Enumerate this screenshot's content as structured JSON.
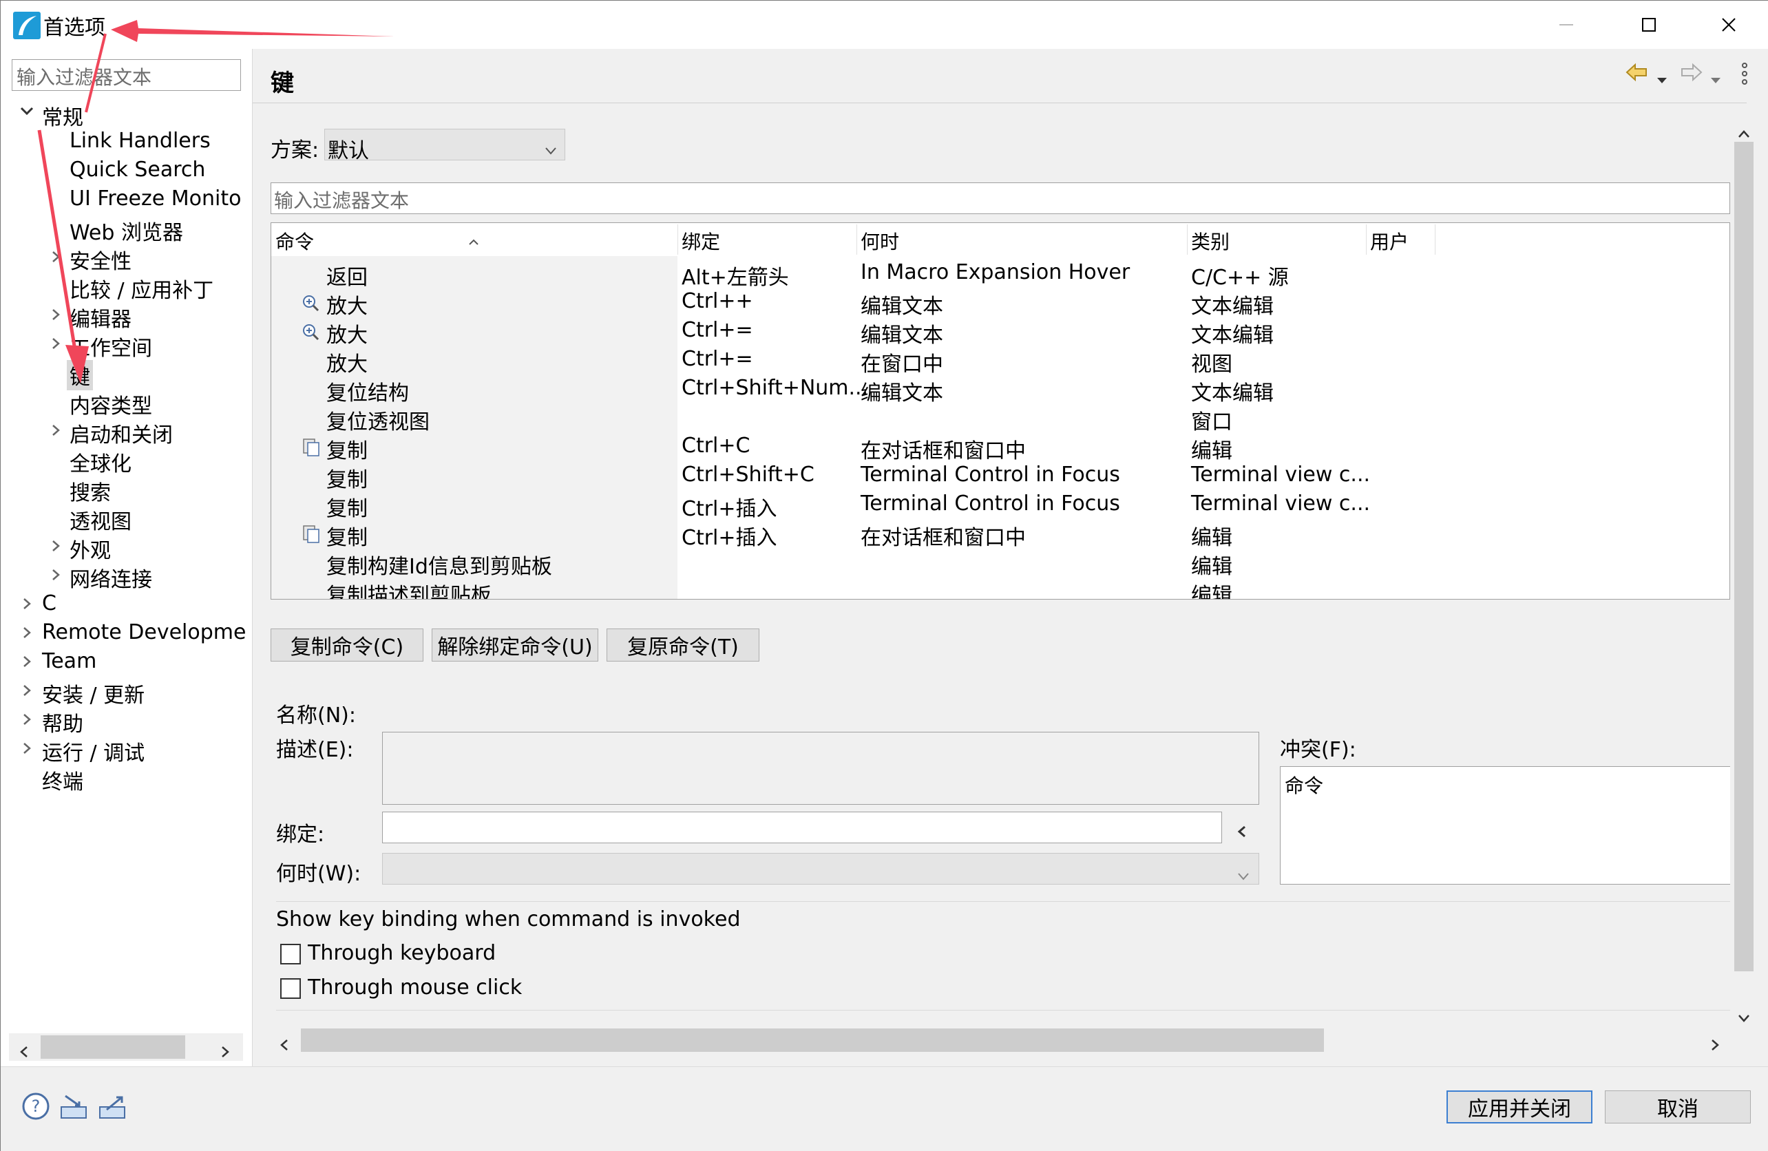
{
  "window": {
    "title": "首选项"
  },
  "left": {
    "filter_placeholder": "输入过滤器文本",
    "tree": [
      {
        "label": "常规",
        "expandable": true,
        "expanded": true
      },
      {
        "label": "Link Handlers"
      },
      {
        "label": "Quick Search"
      },
      {
        "label": "UI Freeze Monito"
      },
      {
        "label": "Web 浏览器"
      },
      {
        "label": "安全性",
        "expandable": true
      },
      {
        "label": "比较 / 应用补丁"
      },
      {
        "label": "编辑器",
        "expandable": true
      },
      {
        "label": "工作空间",
        "expandable": true
      },
      {
        "label": "键",
        "selected": true
      },
      {
        "label": "内容类型"
      },
      {
        "label": "启动和关闭",
        "expandable": true
      },
      {
        "label": "全球化"
      },
      {
        "label": "搜索"
      },
      {
        "label": "透视图"
      },
      {
        "label": "外观",
        "expandable": true
      },
      {
        "label": "网络连接",
        "expandable": true
      },
      {
        "label": "C",
        "expandable": true
      },
      {
        "label": "Remote Developme",
        "expandable": true
      },
      {
        "label": "Team",
        "expandable": true
      },
      {
        "label": "安装 / 更新",
        "expandable": true
      },
      {
        "label": "帮助",
        "expandable": true
      },
      {
        "label": "运行 / 调试",
        "expandable": true
      },
      {
        "label": "终端"
      }
    ]
  },
  "main": {
    "title": "键",
    "scheme_label": "方案:",
    "scheme_value": "默认",
    "filter_placeholder": "输入过滤器文本",
    "columns": [
      "命令",
      "绑定",
      "何时",
      "类别",
      "用户"
    ],
    "rows": [
      {
        "command": "返回",
        "binding": "Alt+左箭头",
        "when": "In Macro Expansion Hover",
        "category": "C/C++ 源",
        "icon": ""
      },
      {
        "command": "放大",
        "binding": "Ctrl++",
        "when": "编辑文本",
        "category": "文本编辑",
        "icon": "zoom-in-icon"
      },
      {
        "command": "放大",
        "binding": "Ctrl+=",
        "when": "编辑文本",
        "category": "文本编辑",
        "icon": "zoom-in-icon"
      },
      {
        "command": "放大",
        "binding": "Ctrl+=",
        "when": "在窗口中",
        "category": "视图",
        "icon": ""
      },
      {
        "command": "复位结构",
        "binding": "Ctrl+Shift+Num...",
        "when": "编辑文本",
        "category": "文本编辑",
        "icon": ""
      },
      {
        "command": "复位透视图",
        "binding": "",
        "when": "",
        "category": "窗口",
        "icon": ""
      },
      {
        "command": "复制",
        "binding": "Ctrl+C",
        "when": "在对话框和窗口中",
        "category": "编辑",
        "icon": "copy-icon"
      },
      {
        "command": "复制",
        "binding": "Ctrl+Shift+C",
        "when": "Terminal Control in Focus",
        "category": "Terminal view c...",
        "icon": ""
      },
      {
        "command": "复制",
        "binding": "Ctrl+插入",
        "when": "Terminal Control in Focus",
        "category": "Terminal view c...",
        "icon": ""
      },
      {
        "command": "复制",
        "binding": "Ctrl+插入",
        "when": "在对话框和窗口中",
        "category": "编辑",
        "icon": "copy-icon"
      },
      {
        "command": "复制构建Id信息到剪贴板",
        "binding": "",
        "when": "",
        "category": "编辑",
        "icon": ""
      },
      {
        "command": "复制描述到剪贴板",
        "binding": "",
        "when": "",
        "category": "编辑",
        "icon": ""
      }
    ],
    "buttons": {
      "copy": "复制命令(C)",
      "unbind": "解除绑定命令(U)",
      "restore": "复原命令(T)"
    },
    "details": {
      "name_label": "名称(N):",
      "desc_label": "描述(E):",
      "binding_label": "绑定:",
      "when_label": "何时(W):",
      "conflict_label": "冲突(F):",
      "conflict_header": "命令"
    },
    "show_binding_label": "Show key binding when command is invoked",
    "checkboxes": [
      {
        "label": "Through keyboard",
        "checked": false
      },
      {
        "label": "Through mouse click",
        "checked": false
      }
    ]
  },
  "footer": {
    "apply_close": "应用并关闭",
    "cancel": "取消"
  },
  "annotation_color": "#f0465a"
}
